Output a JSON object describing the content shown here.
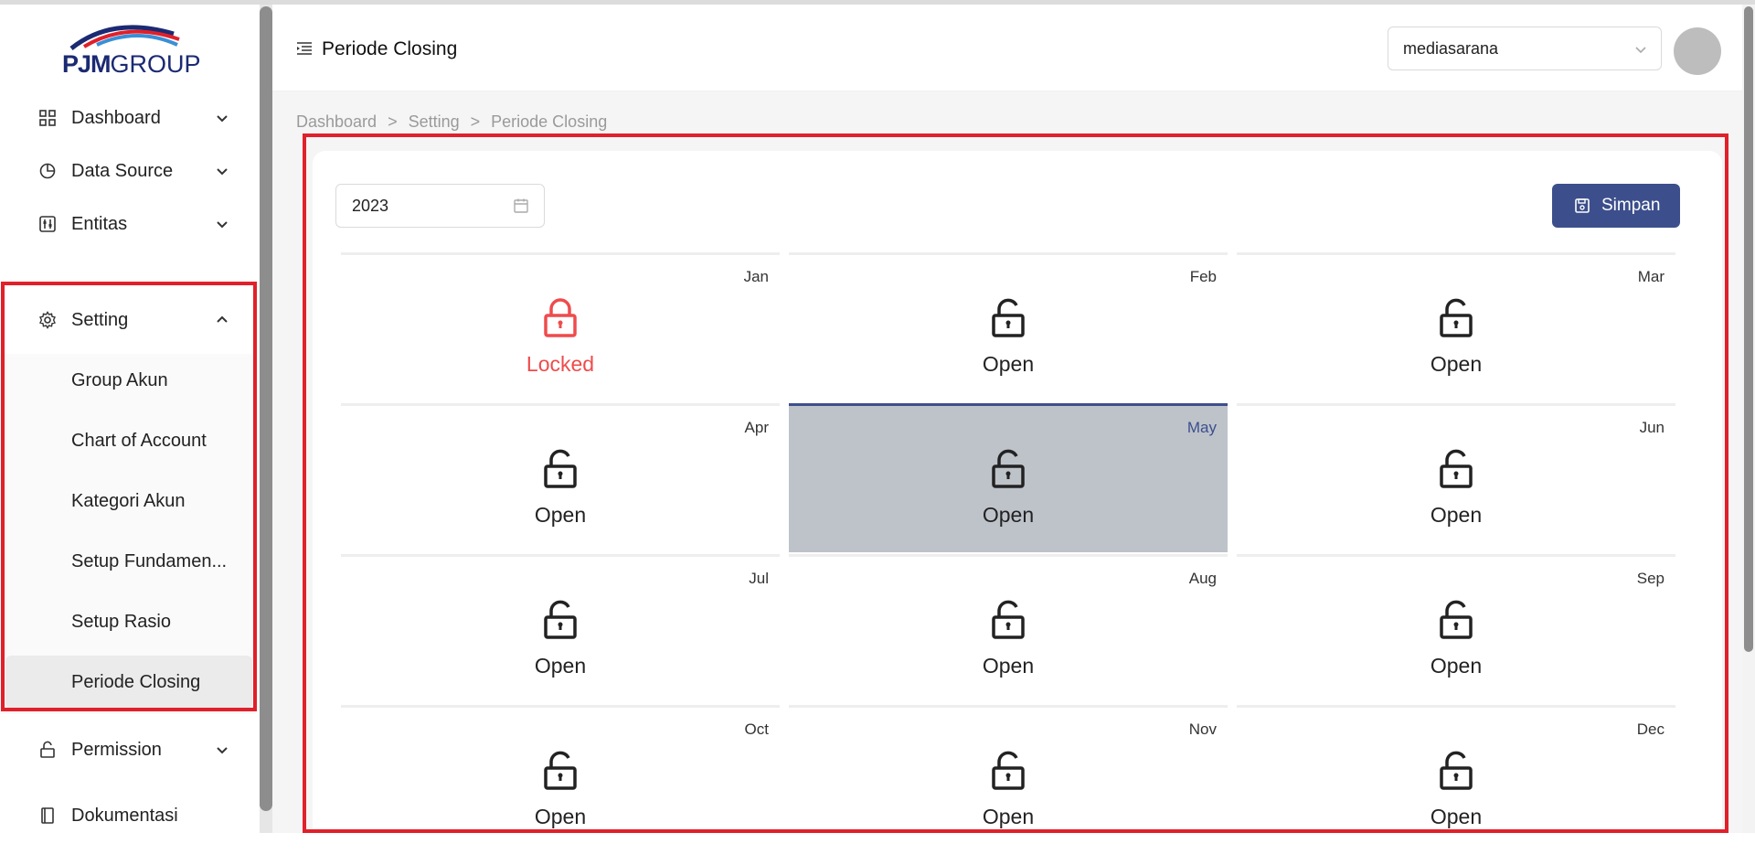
{
  "app": {
    "logo_text_main": "PJM",
    "logo_text_group": "GROUP"
  },
  "sidebar": {
    "items": [
      {
        "label": "Dashboard",
        "icon": "grid-icon",
        "chevron": "chevron-down-icon"
      },
      {
        "label": "Data Source",
        "icon": "pie-chart-icon",
        "chevron": "chevron-down-icon"
      },
      {
        "label": "Entitas",
        "icon": "sliders-icon",
        "chevron": "chevron-down-icon"
      },
      {
        "label": "Setting",
        "icon": "gear-icon",
        "chevron": "chevron-up-icon"
      },
      {
        "label": "Permission",
        "icon": "unlock-icon",
        "chevron": "chevron-down-icon"
      },
      {
        "label": "Dokumentasi",
        "icon": "book-icon"
      }
    ],
    "setting_submenu": [
      {
        "label": "Group Akun"
      },
      {
        "label": "Chart of Account"
      },
      {
        "label": "Kategori Akun"
      },
      {
        "label": "Setup Fundamen..."
      },
      {
        "label": "Setup Rasio"
      },
      {
        "label": "Periode Closing",
        "active": true
      }
    ]
  },
  "header": {
    "title": "Periode Closing",
    "company_select": {
      "value": "mediasarana"
    }
  },
  "breadcrumb": [
    "Dashboard",
    "Setting",
    "Periode Closing"
  ],
  "breadcrumb_separator": ">",
  "filters": {
    "year": "2023"
  },
  "actions": {
    "save_label": "Simpan"
  },
  "months": [
    {
      "name": "Jan",
      "status": "Locked",
      "locked": true
    },
    {
      "name": "Feb",
      "status": "Open"
    },
    {
      "name": "Mar",
      "status": "Open"
    },
    {
      "name": "Apr",
      "status": "Open"
    },
    {
      "name": "May",
      "status": "Open",
      "selected": true
    },
    {
      "name": "Jun",
      "status": "Open"
    },
    {
      "name": "Jul",
      "status": "Open"
    },
    {
      "name": "Aug",
      "status": "Open"
    },
    {
      "name": "Sep",
      "status": "Open"
    },
    {
      "name": "Oct",
      "status": "Open"
    },
    {
      "name": "Nov",
      "status": "Open"
    },
    {
      "name": "Dec",
      "status": "Open"
    }
  ],
  "colors": {
    "primary": "#3c4f8c",
    "locked": "#ef4b4b",
    "highlight": "#e0202a",
    "selected_bg": "#bec3ca"
  }
}
